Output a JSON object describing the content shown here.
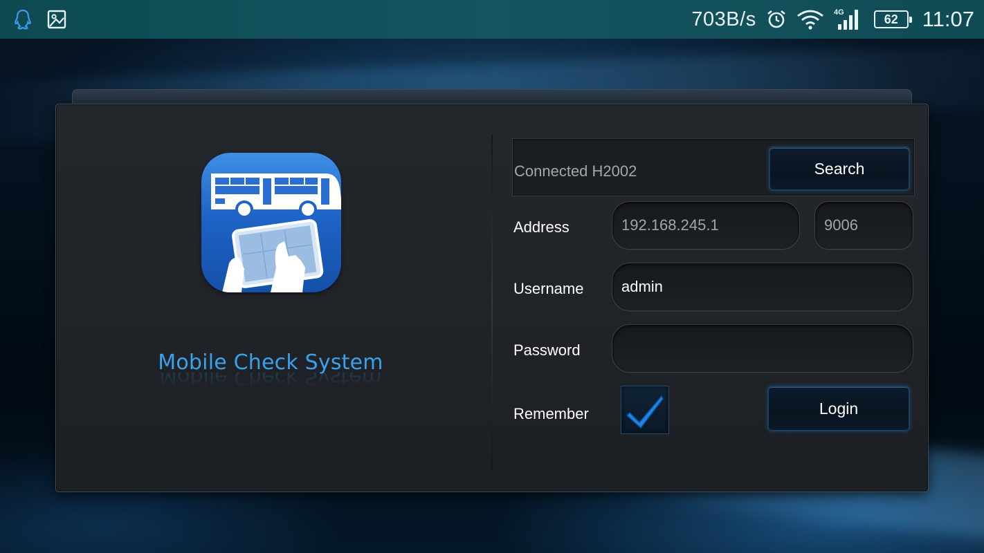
{
  "status_bar": {
    "net_speed": "703B/s",
    "network_type": "4G",
    "battery": "62",
    "time": "11:07",
    "icons": [
      "qq-notification-icon",
      "image-notification-icon",
      "alarm-icon",
      "wifi-icon",
      "signal-icon",
      "battery-icon"
    ]
  },
  "app": {
    "title": "Mobile Check System",
    "logo_icon": "bus-tablet-logo-icon",
    "accent_color": "#3aa2ea"
  },
  "connection": {
    "status_text": "Connected H2002",
    "search_label": "Search"
  },
  "form": {
    "address_label": "Address",
    "address_value": "192.168.245.1",
    "port_value": "9006",
    "username_label": "Username",
    "username_value": "admin",
    "password_label": "Password",
    "password_value": "",
    "remember_label": "Remember",
    "remember_checked": true,
    "login_label": "Login"
  }
}
